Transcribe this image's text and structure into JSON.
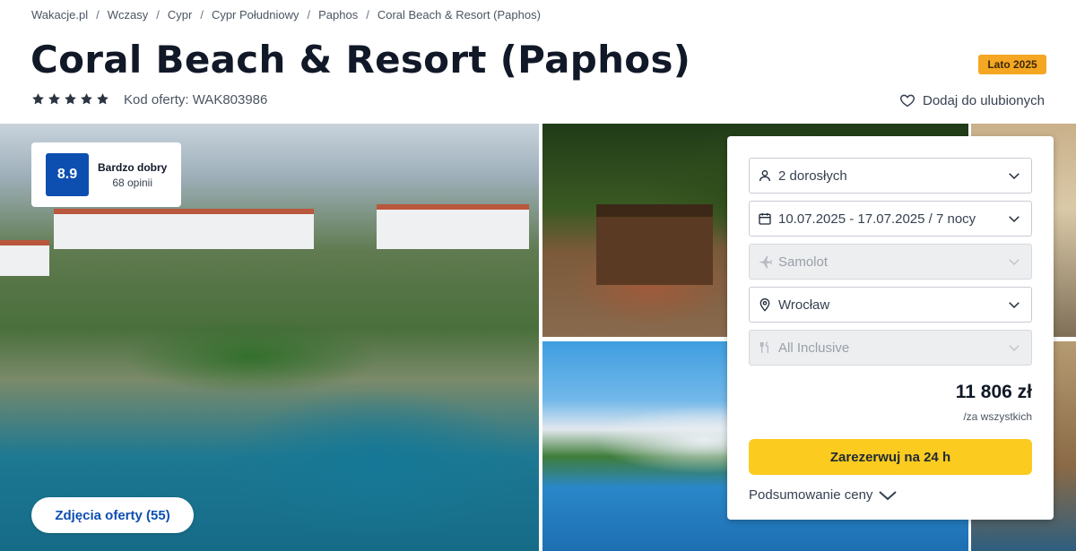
{
  "breadcrumb": [
    "Wakacje.pl",
    "Wczasy",
    "Cypr",
    "Cypr Południowy",
    "Paphos",
    "Coral Beach & Resort (Paphos)"
  ],
  "breadcrumb_separator": "/",
  "hotel": {
    "title": "Coral Beach & Resort (Paphos)",
    "season_badge": "Lato 2025",
    "stars": 5,
    "offer_code": "Kod oferty: WAK803986",
    "favorite_label": "Dodaj do ulubionych"
  },
  "rating": {
    "score": "8.9",
    "label": "Bardzo dobry",
    "count": "68 opinii"
  },
  "gallery": {
    "photos_button": "Zdjęcia oferty (55)"
  },
  "booking": {
    "travelers": "2 dorosłych",
    "dates": "10.07.2025 - 17.07.2025 / 7 nocy",
    "transport": "Samolot",
    "departure": "Wrocław",
    "board": "All Inclusive",
    "price": "11 806 zł",
    "price_note": "/za wszystkich",
    "book_button": "Zarezerwuj na 24 h",
    "summary_link": "Podsumowanie ceny"
  },
  "colors": {
    "accent_blue": "#0d4fb1",
    "book_yellow": "#fccb1f",
    "badge_orange": "#f5a623"
  }
}
